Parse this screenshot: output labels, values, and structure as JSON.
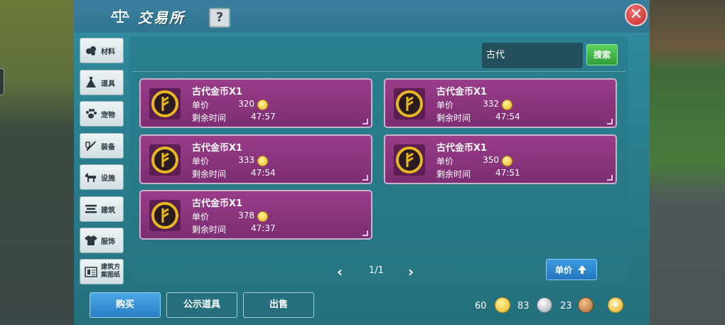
{
  "window": {
    "title": "交易所",
    "help_label": "?",
    "close_label": "✕"
  },
  "categories": [
    {
      "label": "材料",
      "icon": "material-icon"
    },
    {
      "label": "道具",
      "icon": "item-icon"
    },
    {
      "label": "宠物",
      "icon": "pet-paw-icon"
    },
    {
      "label": "装备",
      "icon": "equipment-icon"
    },
    {
      "label": "设施",
      "icon": "facility-icon"
    },
    {
      "label": "建筑",
      "icon": "building-icon"
    },
    {
      "label": "服饰",
      "icon": "clothing-icon"
    },
    {
      "label": "建筑方案图纸",
      "icon": "blueprint-icon"
    }
  ],
  "search": {
    "value": "古代",
    "button_label": "搜索"
  },
  "listings": [
    {
      "name": "古代金币X1",
      "price_label": "单价",
      "price": "320",
      "time_label": "剩余时间",
      "time": "47:57"
    },
    {
      "name": "古代金币X1",
      "price_label": "单价",
      "price": "332",
      "time_label": "剩余时间",
      "time": "47:54"
    },
    {
      "name": "古代金币X1",
      "price_label": "单价",
      "price": "333",
      "time_label": "剩余时间",
      "time": "47:54"
    },
    {
      "name": "古代金币X1",
      "price_label": "单价",
      "price": "350",
      "time_label": "剩余时间",
      "time": "47:51"
    },
    {
      "name": "古代金币X1",
      "price_label": "单价",
      "price": "378",
      "time_label": "剩余时间",
      "time": "47:37"
    }
  ],
  "pagination": {
    "prev": "‹",
    "text": "1/1",
    "next": "›"
  },
  "sort": {
    "label": "单价"
  },
  "actions": {
    "buy": "购买",
    "showcase": "公示道具",
    "sell": "出售"
  },
  "currency": {
    "gold": "60",
    "gold_coin": "83",
    "silver": "23"
  },
  "colors": {
    "card_bg": "#8a3480",
    "panel_bg": "#2a7f8f",
    "accent_blue": "#2a7ec4",
    "search_green": "#2f9e3c",
    "close_red": "#c52828"
  }
}
